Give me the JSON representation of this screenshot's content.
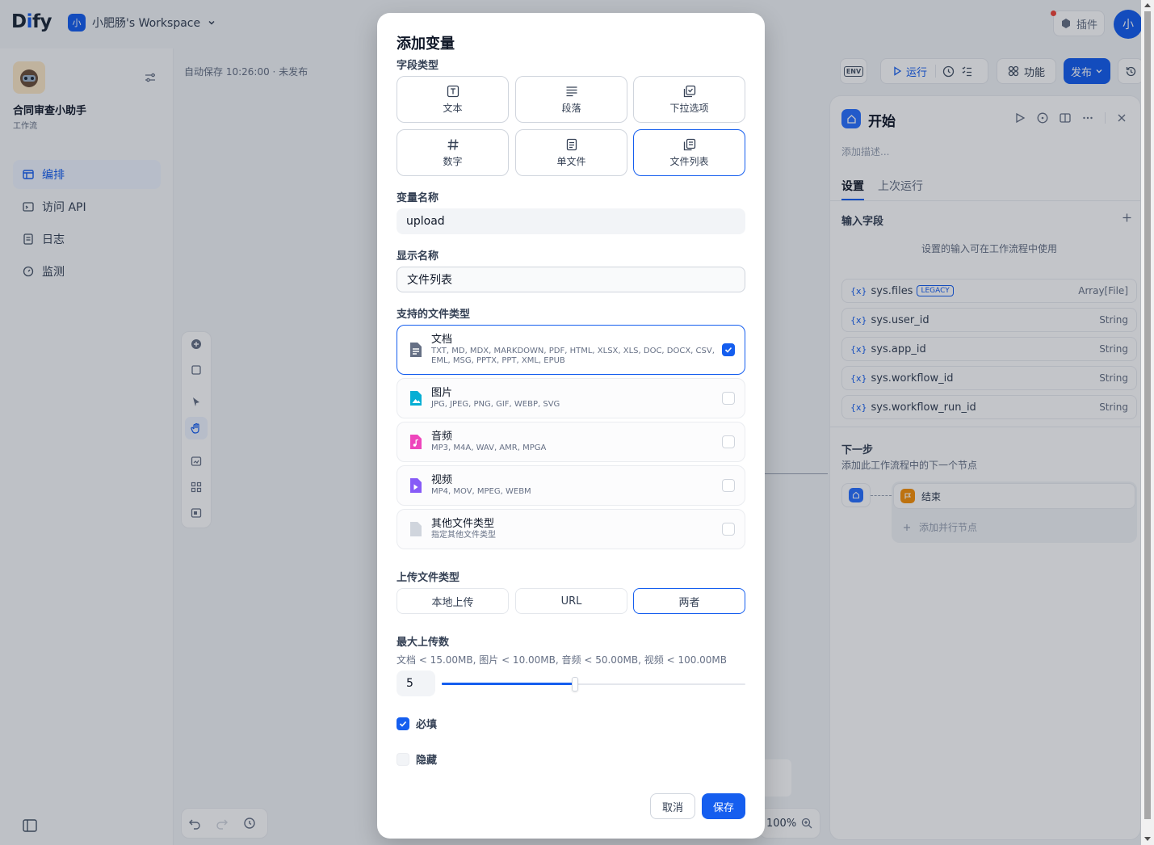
{
  "header": {
    "logo_prefix": "D",
    "logo_mid": "i",
    "logo_suffix": "fy",
    "workspace_badge": "小",
    "workspace_name": "小肥肠's Workspace",
    "plugin_label": "插件",
    "user_avatar": "小"
  },
  "sidebar": {
    "app_name": "合同审查小助手",
    "app_type": "工作流",
    "items": [
      {
        "label": "编排",
        "icon": "layout-icon"
      },
      {
        "label": "访问 API",
        "icon": "terminal-icon"
      },
      {
        "label": "日志",
        "icon": "file-list-icon"
      },
      {
        "label": "监测",
        "icon": "gauge-icon"
      }
    ]
  },
  "canvas": {
    "autosave": "自动保存 10:26:00 · 未发布",
    "zoom": "100%"
  },
  "toolbar": {
    "env_label": "ENV",
    "run_label": "运行",
    "feature_label": "功能",
    "publish_label": "发布"
  },
  "panel": {
    "title": "开始",
    "description_placeholder": "添加描述...",
    "tab_settings": "设置",
    "tab_last_run": "上次运行",
    "input_fields_label": "输入字段",
    "empty_hint": "设置的输入可在工作流程中使用",
    "variables": [
      {
        "name": "sys.files",
        "badge": "LEGACY",
        "type": "Array[File]"
      },
      {
        "name": "sys.user_id",
        "badge": "",
        "type": "String"
      },
      {
        "name": "sys.app_id",
        "badge": "",
        "type": "String"
      },
      {
        "name": "sys.workflow_id",
        "badge": "",
        "type": "String"
      },
      {
        "name": "sys.workflow_run_id",
        "badge": "",
        "type": "String"
      }
    ],
    "next_step_title": "下一步",
    "next_step_desc": "添加此工作流程中的下一个节点",
    "end_node_label": "结束",
    "add_parallel_label": "添加并行节点"
  },
  "modal": {
    "title": "添加变量",
    "field_type_label": "字段类型",
    "field_types": [
      {
        "label": "文本",
        "icon": "text-icon",
        "selected": false
      },
      {
        "label": "段落",
        "icon": "paragraph-icon",
        "selected": false
      },
      {
        "label": "下拉选项",
        "icon": "select-icon",
        "selected": false
      },
      {
        "label": "数字",
        "icon": "hash-icon",
        "selected": false
      },
      {
        "label": "单文件",
        "icon": "file-icon",
        "selected": false
      },
      {
        "label": "文件列表",
        "icon": "file-list-icon",
        "selected": true
      }
    ],
    "var_name_label": "变量名称",
    "var_name_value": "upload",
    "display_name_label": "显示名称",
    "display_name_value": "文件列表",
    "supported_types_label": "支持的文件类型",
    "file_types": [
      {
        "title": "文档",
        "desc": "TXT, MD, MDX, MARKDOWN, PDF, HTML, XLSX, XLS, DOC, DOCX, CSV, EML, MSG, PPTX, PPT, XML, EPUB",
        "checked": true,
        "color": "#667085",
        "icon": "document-icon"
      },
      {
        "title": "图片",
        "desc": "JPG, JPEG, PNG, GIF, WEBP, SVG",
        "checked": false,
        "color": "#06aed4",
        "icon": "image-icon"
      },
      {
        "title": "音频",
        "desc": "MP3, M4A, WAV, AMR, MPGA",
        "checked": false,
        "color": "#ee46bc",
        "icon": "audio-icon"
      },
      {
        "title": "视频",
        "desc": "MP4, MOV, MPEG, WEBM",
        "checked": false,
        "color": "#875bf7",
        "icon": "video-icon"
      },
      {
        "title": "其他文件类型",
        "desc": "指定其他文件类型",
        "checked": false,
        "color": "#d0d5dd",
        "icon": "other-file-icon"
      }
    ],
    "upload_type_label": "上传文件类型",
    "upload_options": [
      {
        "label": "本地上传",
        "selected": false
      },
      {
        "label": "URL",
        "selected": false
      },
      {
        "label": "两者",
        "selected": true
      }
    ],
    "max_upload_label": "最大上传数",
    "max_upload_hint": "文档 < 15.00MB, 图片 < 10.00MB, 音频 < 50.00MB, 视频 < 100.00MB",
    "max_upload_value": "5",
    "slider_fraction": 0.44,
    "required_label": "必填",
    "required_checked": true,
    "hidden_label": "隐藏",
    "hidden_checked": false,
    "cancel_label": "取消",
    "save_label": "保存"
  },
  "colors": {
    "accent": "#155eef",
    "overlay": "rgba(16,24,40,0.25)"
  }
}
